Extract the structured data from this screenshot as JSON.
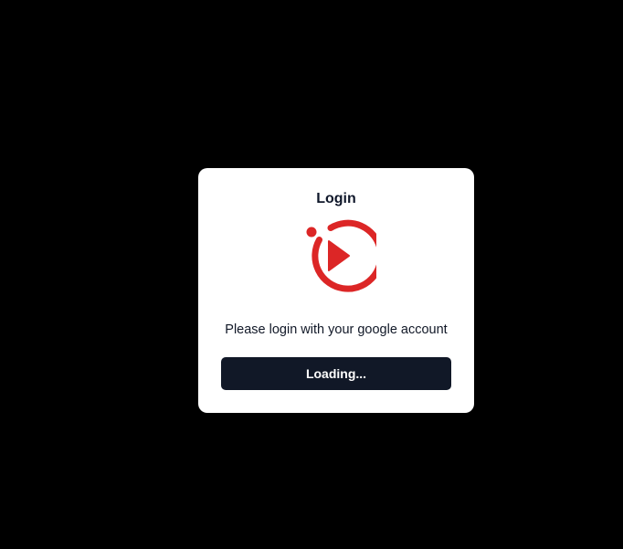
{
  "modal": {
    "title": "Login",
    "message": "Please login with your google account",
    "button_label": "Loading..."
  },
  "logo": {
    "icon": "play-circle-logo-icon",
    "color": "#dc2626"
  },
  "colors": {
    "background": "#000000",
    "card": "#ffffff",
    "button": "#111827",
    "button_text": "#ffffff",
    "text": "#0f172a"
  }
}
